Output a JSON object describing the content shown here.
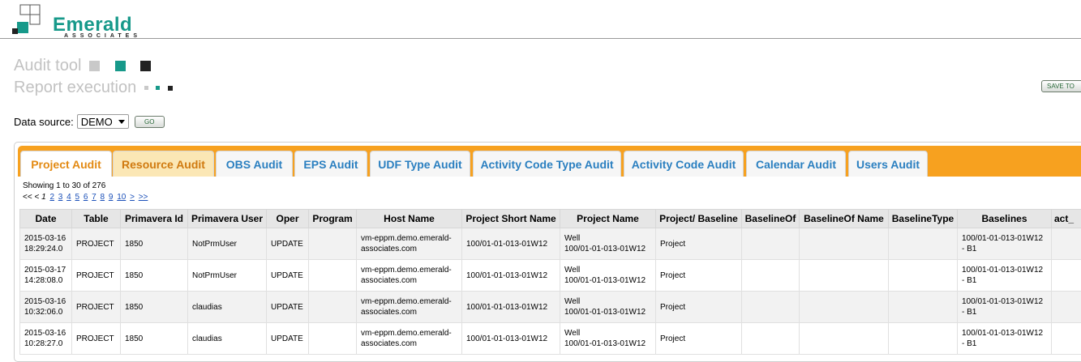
{
  "brand": {
    "name": "Emerald",
    "sub": "ASSOCIATES"
  },
  "titles": {
    "app": "Audit tool",
    "page": "Report execution"
  },
  "colors": {
    "teal": "#17998a",
    "orange": "#f7a11f",
    "tab_text": "#2a7fc0",
    "active_tab_text": "#e38a13",
    "grey": "#c2c2c2",
    "black": "#222222"
  },
  "save_button": "SAVE TO",
  "datasource": {
    "label": "Data source:",
    "value": "DEMO",
    "go": "GO"
  },
  "tabs": [
    {
      "label": "Project Audit"
    },
    {
      "label": "Resource Audit"
    },
    {
      "label": "OBS Audit"
    },
    {
      "label": "EPS Audit"
    },
    {
      "label": "UDF Type Audit"
    },
    {
      "label": "Activity Code Type Audit"
    },
    {
      "label": "Activity Code Audit"
    },
    {
      "label": "Calendar Audit"
    },
    {
      "label": "Users Audit"
    }
  ],
  "table_info": {
    "showing": "Showing 1 to 30 of 276",
    "first": "<<",
    "prev": "<",
    "current_page": "1",
    "pages": [
      "2",
      "3",
      "4",
      "5",
      "6",
      "7",
      "8",
      "9",
      "10"
    ],
    "next": ">",
    "last": ">>"
  },
  "columns": [
    "Date",
    "Table",
    "Primavera Id",
    "Primavera User",
    "Oper",
    "Program",
    "Host Name",
    "Project Short Name",
    "Project Name",
    "Project/ Baseline",
    "BaselineOf",
    "BaselineOf Name",
    "BaselineType",
    "Baselines",
    "act_"
  ],
  "rows": [
    {
      "date1": "2015-03-16",
      "date2": "18:29:24.0",
      "table": "PROJECT",
      "pid": "1850",
      "user": "NotPrmUser",
      "oper": "UPDATE",
      "program": "",
      "host1": "vm-eppm.demo.emerald-",
      "host2": "associates.com",
      "short": "100/01-01-013-01W12",
      "pname1": "Well",
      "pname2": "100/01-01-013-01W12",
      "pb": "Project",
      "bof": "",
      "bofn": "",
      "btype": "",
      "bl1": "100/01-01-013-01W12",
      "bl2": "- B1",
      "act": ""
    },
    {
      "date1": "2015-03-17",
      "date2": "14:28:08.0",
      "table": "PROJECT",
      "pid": "1850",
      "user": "NotPrmUser",
      "oper": "UPDATE",
      "program": "",
      "host1": "vm-eppm.demo.emerald-",
      "host2": "associates.com",
      "short": "100/01-01-013-01W12",
      "pname1": "Well",
      "pname2": "100/01-01-013-01W12",
      "pb": "Project",
      "bof": "",
      "bofn": "",
      "btype": "",
      "bl1": "100/01-01-013-01W12",
      "bl2": "- B1",
      "act": ""
    },
    {
      "date1": "2015-03-16",
      "date2": "10:32:06.0",
      "table": "PROJECT",
      "pid": "1850",
      "user": "claudias",
      "oper": "UPDATE",
      "program": "",
      "host1": "vm-eppm.demo.emerald-",
      "host2": "associates.com",
      "short": "100/01-01-013-01W12",
      "pname1": "Well",
      "pname2": "100/01-01-013-01W12",
      "pb": "Project",
      "bof": "",
      "bofn": "",
      "btype": "",
      "bl1": "100/01-01-013-01W12",
      "bl2": "- B1",
      "act": ""
    },
    {
      "date1": "2015-03-16",
      "date2": "10:28:27.0",
      "table": "PROJECT",
      "pid": "1850",
      "user": "claudias",
      "oper": "UPDATE",
      "program": "",
      "host1": "vm-eppm.demo.emerald-",
      "host2": "associates.com",
      "short": "100/01-01-013-01W12",
      "pname1": "Well",
      "pname2": "100/01-01-013-01W12",
      "pb": "Project",
      "bof": "",
      "bofn": "",
      "btype": "",
      "bl1": "100/01-01-013-01W12",
      "bl2": "- B1",
      "act": ""
    }
  ]
}
